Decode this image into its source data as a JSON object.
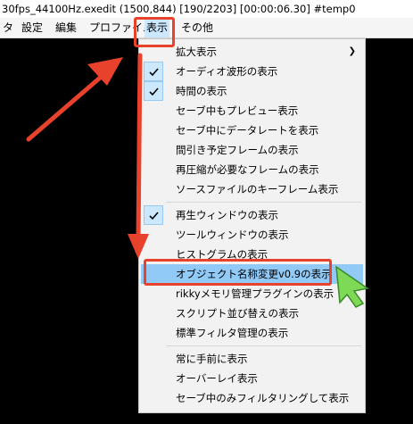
{
  "window": {
    "title": "30fps_44100Hz.exedit (1500,844)  [190/2203]  [00:00:06.30]  #temp0"
  },
  "menubar": {
    "items": [
      "タ",
      "設定",
      "編集",
      "プロファイル",
      "表示",
      "その他"
    ]
  },
  "dropdown": {
    "items": [
      {
        "label": "拡大表示",
        "checked": false,
        "submenu_icon": "chevron-right-icon"
      },
      {
        "label": "オーディオ波形の表示",
        "checked": true
      },
      {
        "label": "時間の表示",
        "checked": true
      },
      {
        "label": "セーブ中もプレビュー表示",
        "checked": false
      },
      {
        "label": "セーブ中にデータレートを表示",
        "checked": false
      },
      {
        "label": "間引き予定フレームの表示",
        "checked": false
      },
      {
        "label": "再圧縮が必要なフレームの表示",
        "checked": false
      },
      {
        "label": "ソースファイルのキーフレーム表示",
        "checked": false
      },
      {
        "label": "再生ウィンドウの表示",
        "checked": true
      },
      {
        "label": "ツールウィンドウの表示",
        "checked": false
      },
      {
        "label": "ヒストグラムの表示",
        "checked": false
      },
      {
        "label": "オブジェクト名称変更v0.9の表示",
        "checked": false,
        "highlighted": true
      },
      {
        "label": "rikkyメモリ管理プラグインの表示",
        "checked": false
      },
      {
        "label": "スクリプト並び替えの表示",
        "checked": false
      },
      {
        "label": "標準フィルタ管理の表示",
        "checked": false
      },
      {
        "label": "常に手前に表示",
        "checked": false
      },
      {
        "label": "オーバーレイ表示",
        "checked": false
      },
      {
        "label": "セーブ中のみフィルタリングして表示",
        "checked": false
      }
    ]
  },
  "colors": {
    "annotation_red": "#e8412c",
    "cursor_green": "#7ed957",
    "highlight": "#91c9f7",
    "check_bg": "#cce8ff"
  }
}
